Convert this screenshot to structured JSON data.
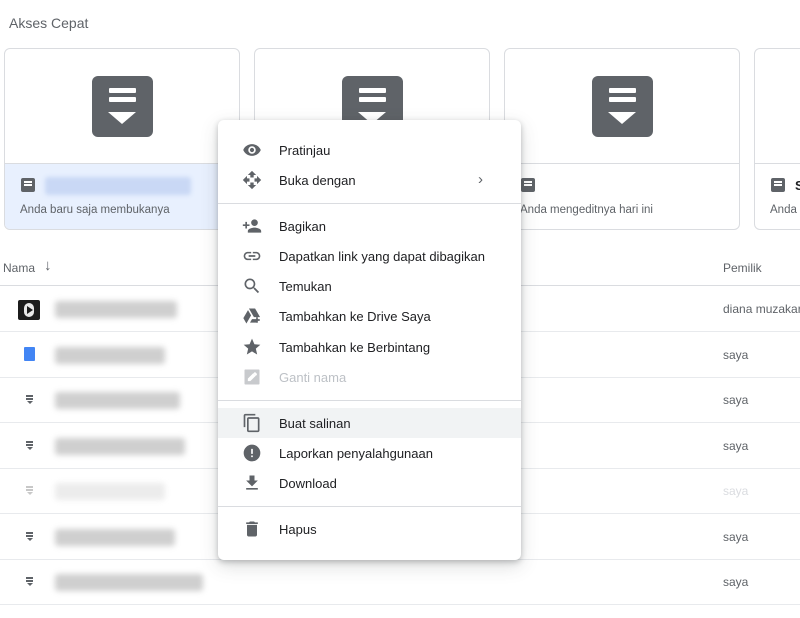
{
  "quick_access": {
    "title": "Akses Cepat",
    "cards": [
      {
        "name": "",
        "subtitle": "Anda baru saja membukanya",
        "active": true
      },
      {
        "name": "",
        "subtitle": "",
        "active": false
      },
      {
        "name": "",
        "subtitle": "Anda mengeditnya hari ini",
        "active": false
      },
      {
        "name": "S",
        "subtitle": "Anda",
        "active": false
      }
    ]
  },
  "file_list": {
    "columns": {
      "name": "Nama",
      "sort_icon": "arrow-down-icon",
      "owner": "Pemilik"
    },
    "rows": [
      {
        "icon": "video-icon",
        "owner": "diana muzakar"
      },
      {
        "icon": "google-doc-icon",
        "owner": "saya"
      },
      {
        "icon": "unknown-file-icon",
        "owner": "saya"
      },
      {
        "icon": "unknown-file-icon",
        "owner": "saya"
      },
      {
        "icon": "unknown-file-icon",
        "owner": "saya"
      },
      {
        "icon": "unknown-file-icon",
        "owner": "saya"
      },
      {
        "icon": "unknown-file-icon",
        "owner": "saya"
      }
    ]
  },
  "context_menu": {
    "items": [
      {
        "label": "Pratinjau",
        "icon": "eye-icon"
      },
      {
        "label": "Buka dengan",
        "icon": "open-with-icon",
        "submenu_icon": "chevron-right-icon"
      },
      {
        "label": "Bagikan",
        "icon": "person-add-icon"
      },
      {
        "label": "Dapatkan link yang dapat dibagikan",
        "icon": "link-icon"
      },
      {
        "label": "Temukan",
        "icon": "search-icon"
      },
      {
        "label": "Tambahkan ke Drive Saya",
        "icon": "add-to-drive-icon"
      },
      {
        "label": "Tambahkan ke Berbintang",
        "icon": "star-icon"
      },
      {
        "label": "Ganti nama",
        "icon": "rename-icon",
        "disabled": true
      },
      {
        "label": "Buat salinan",
        "icon": "copy-icon",
        "highlighted": true
      },
      {
        "label": "Laporkan penyalahgunaan",
        "icon": "report-icon"
      },
      {
        "label": "Download",
        "icon": "download-icon"
      },
      {
        "label": "Hapus",
        "icon": "trash-icon"
      }
    ]
  },
  "colors": {
    "icon_gray": "#5f6368",
    "accent_blue": "#4285f4",
    "selection": "#e8f0fe"
  }
}
